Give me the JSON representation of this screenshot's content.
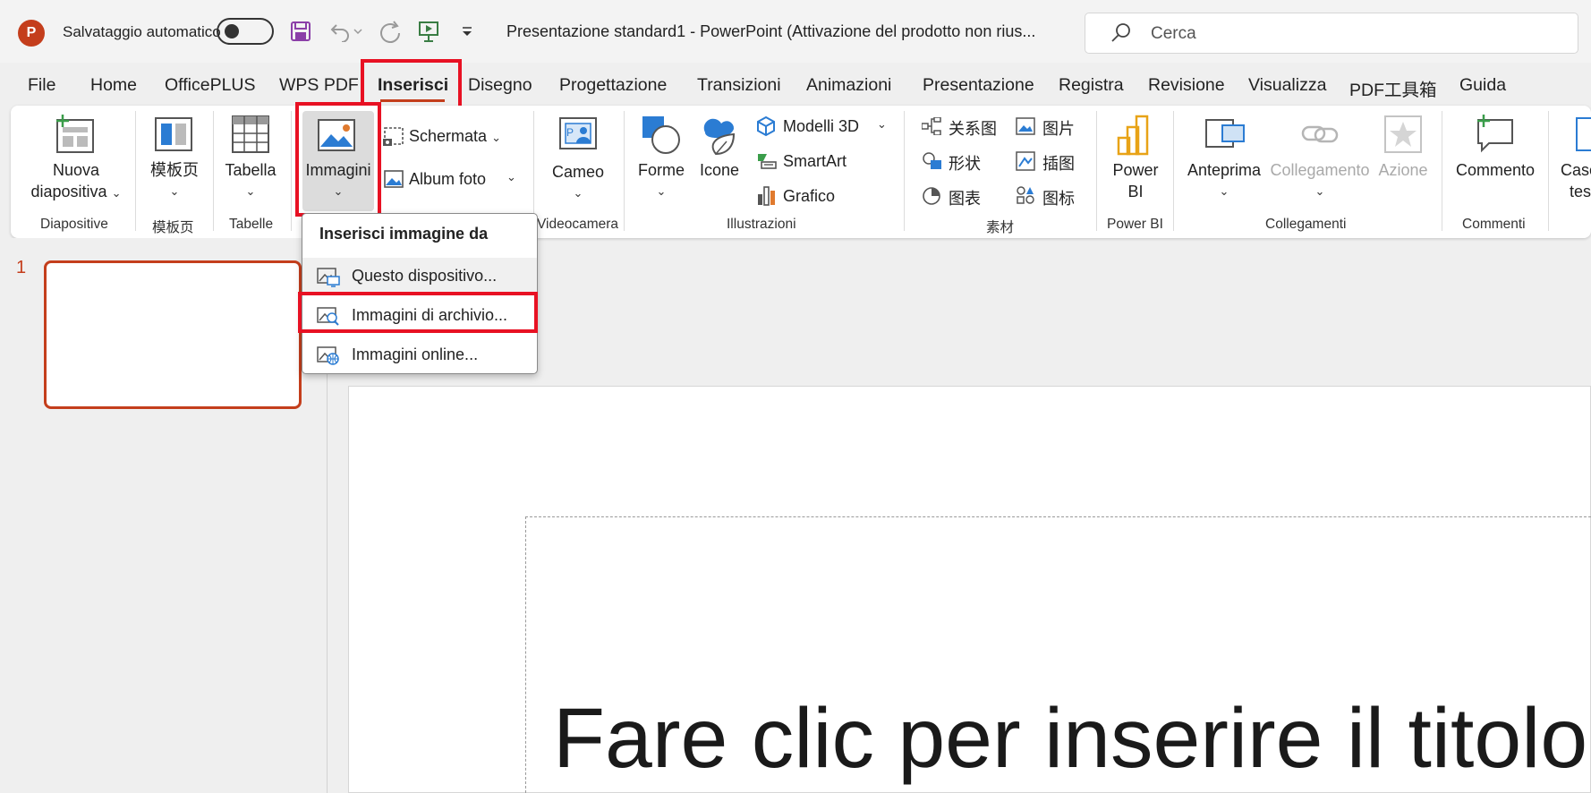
{
  "titlebar": {
    "app_logo": "P",
    "autosave_label": "Salvataggio automatico",
    "doc_title": "Presentazione standard1  -  PowerPoint (Attivazione del prodotto non rius...",
    "search_placeholder": "Cerca"
  },
  "tabs": [
    "File",
    "Home",
    "OfficePLUS",
    "WPS PDF",
    "Inserisci",
    "Disegno",
    "Progettazione",
    "Transizioni",
    "Animazioni",
    "Presentazione",
    "Registra",
    "Revisione",
    "Visualizza",
    "PDF工具箱",
    "Guida"
  ],
  "active_tab": "Inserisci",
  "ribbon": {
    "nuova": [
      "Nuova",
      "diapositiva"
    ],
    "moban": "模板页",
    "tabella": "Tabella",
    "immagini": "Immagini",
    "schermata": "Schermata",
    "album": "Album foto",
    "cameo": "Cameo",
    "forme": "Forme",
    "icone": "Icone",
    "modelli3d": "Modelli 3D",
    "smartart": "SmartArt",
    "grafico": "Grafico",
    "cn_items": [
      "关系图",
      "形状",
      "图表",
      "图片",
      "插图",
      "图标"
    ],
    "powerbi": [
      "Power",
      "BI"
    ],
    "anteprima": "Anteprima",
    "collegamento": "Collegamento",
    "azione": "Azione",
    "commento": "Commento",
    "casella": [
      "Case",
      "tes"
    ],
    "groups": [
      "Diapositive",
      "模板页",
      "Tabelle",
      "Videocamera",
      "Illustrazioni",
      "素材",
      "Power BI",
      "Collegamenti",
      "Commenti"
    ]
  },
  "dropdown": {
    "header": "Inserisci immagine da",
    "items": [
      "Questo dispositivo...",
      "Immagini di archivio...",
      "Immagini online..."
    ]
  },
  "slides": {
    "number": "1",
    "title_placeholder": "Fare clic per inserire il titolo"
  },
  "colors": {
    "accent": "#c43e1c",
    "highlight": "#e81123",
    "icon_blue": "#2b7cd3"
  }
}
